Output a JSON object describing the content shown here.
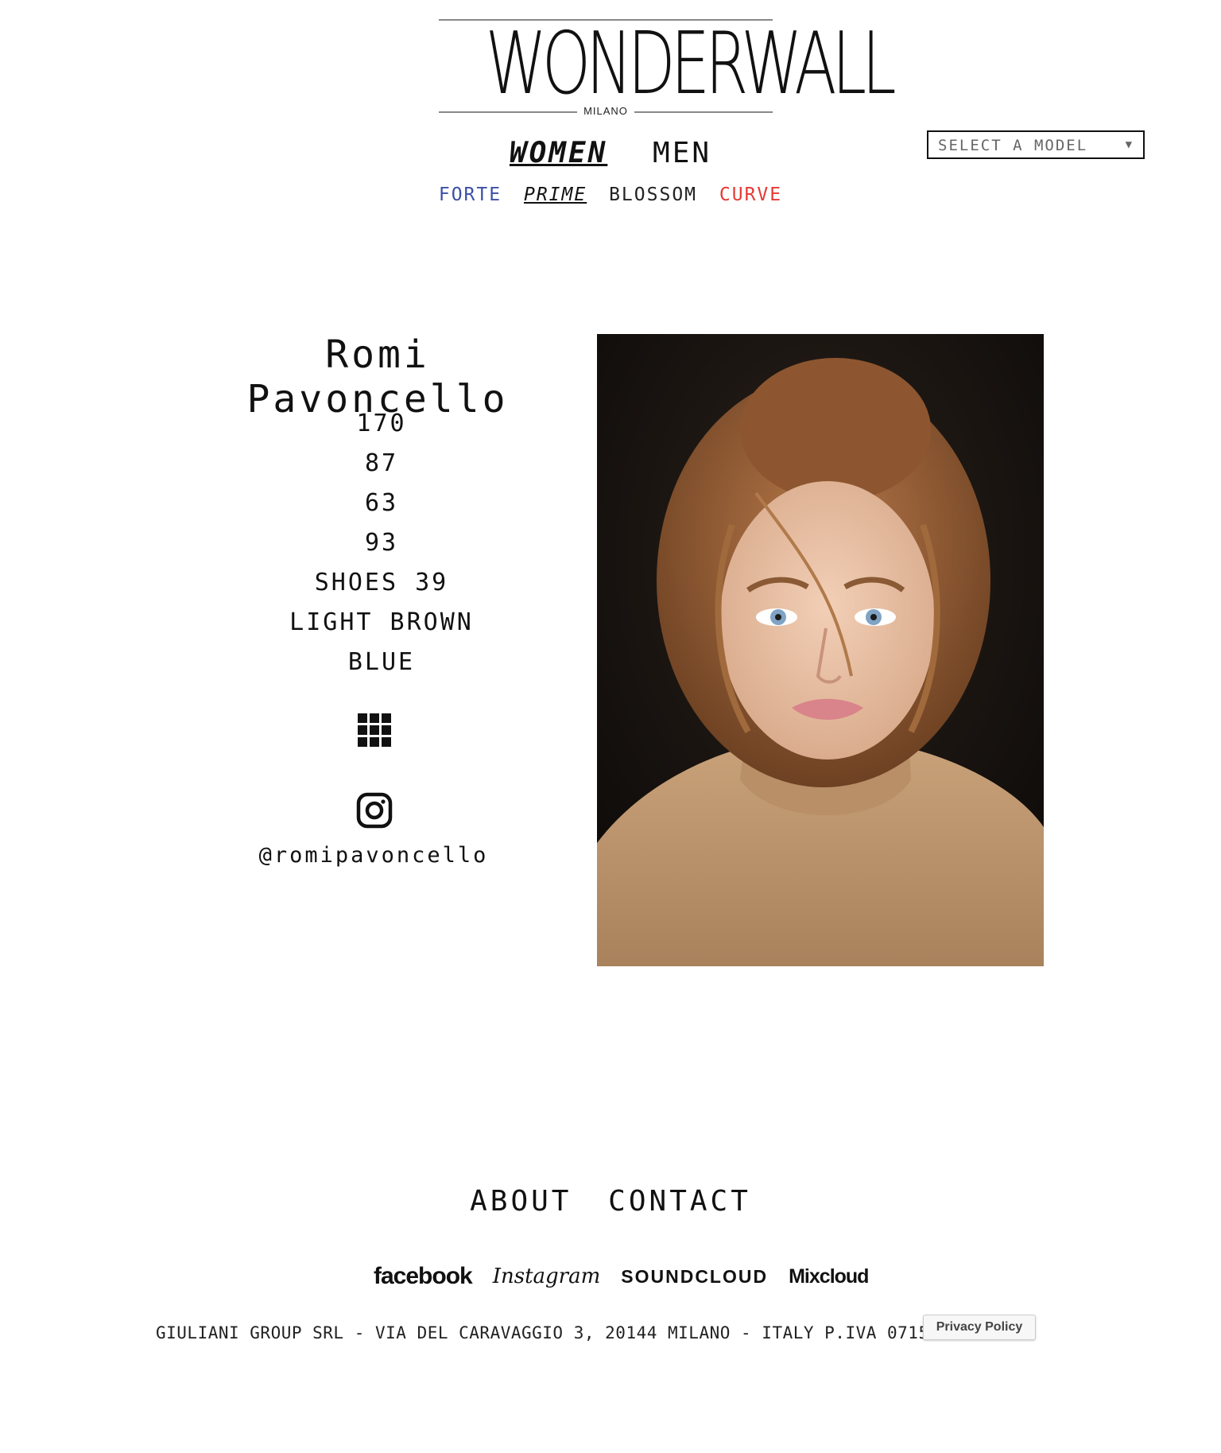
{
  "brand": {
    "wordmark": "WONDERWALL",
    "subtitle": "MILANO"
  },
  "main_nav": [
    {
      "label": "WOMEN",
      "active": true
    },
    {
      "label": "MEN",
      "active": false
    }
  ],
  "sub_nav": [
    {
      "label": "FORTE",
      "color": "#3b4fa8",
      "active": false
    },
    {
      "label": "PRIME",
      "color": "#111111",
      "active": true
    },
    {
      "label": "BLOSSOM",
      "color": "#222222",
      "active": false
    },
    {
      "label": "CURVE",
      "color": "#e53935",
      "active": false
    }
  ],
  "model_select": {
    "placeholder": "SELECT A MODEL"
  },
  "model": {
    "name": "Romi Pavoncello",
    "stats": [
      "170",
      "87",
      "63",
      "93",
      "SHOES 39",
      "LIGHT BROWN",
      "BLUE"
    ],
    "instagram_handle": "@romipavoncello"
  },
  "icons": {
    "gallery": "grid-icon",
    "instagram": "instagram-icon"
  },
  "footer": {
    "nav": [
      "ABOUT",
      "CONTACT"
    ],
    "social": {
      "facebook": "facebook",
      "instagram": "Instagram",
      "soundcloud": "SOUNDCLOUD",
      "mixcloud": "Mixcloud"
    },
    "legal": "GIULIANI GROUP SRL - VIA DEL CARAVAGGIO 3, 20144 MILANO - ITALY P.IVA 07157750964 -",
    "privacy_label": "Privacy Policy"
  }
}
